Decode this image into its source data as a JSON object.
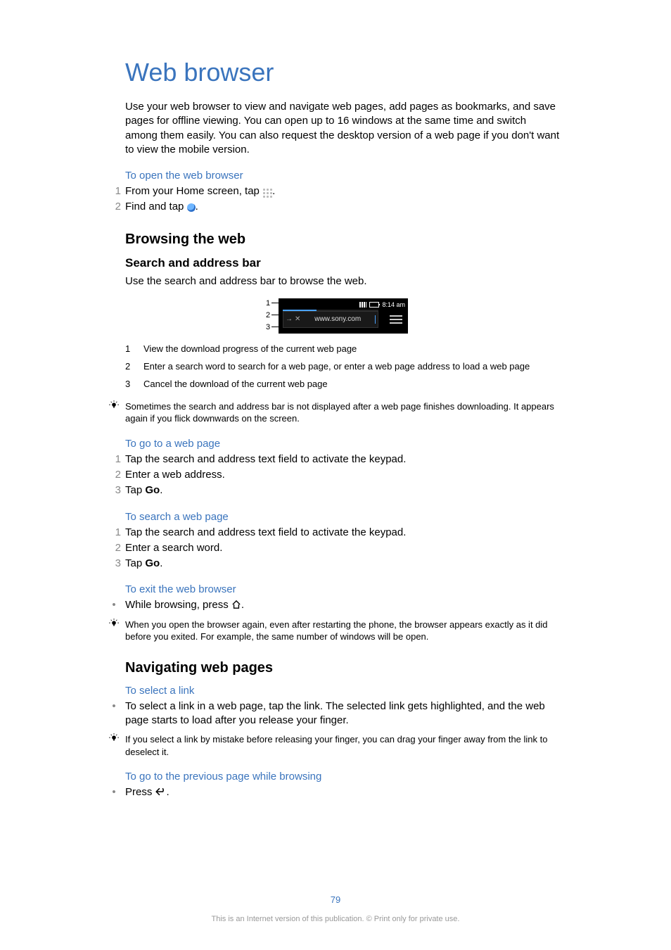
{
  "title": "Web browser",
  "intro": "Use your web browser to view and navigate web pages, add pages as bookmarks, and save pages for offline viewing. You can open up to 16 windows at the same time and switch among them easily. You can also request the desktop version of a web page if you don't want to view the mobile version.",
  "open_browser": {
    "heading": "To open the web browser",
    "steps": [
      {
        "n": "1",
        "pre": "From your Home screen, tap ",
        "post": "."
      },
      {
        "n": "2",
        "pre": "Find and tap ",
        "post": "."
      }
    ]
  },
  "browsing_h2": "Browsing the web",
  "search_bar": {
    "h3": "Search and address bar",
    "body": "Use the search and address bar to browse the web.",
    "callouts": [
      "1",
      "2",
      "3"
    ],
    "mock": {
      "time": "8:14 am",
      "url": "www.sony.com"
    },
    "legend": [
      {
        "n": "1",
        "t": "View the download progress of the current web page"
      },
      {
        "n": "2",
        "t": "Enter a search word to search for a web page, or enter a web page address to load a web page"
      },
      {
        "n": "3",
        "t": "Cancel the download of the current web page"
      }
    ],
    "tip": "Sometimes the search and address bar is not displayed after a web page finishes downloading. It appears again if you flick downwards on the screen."
  },
  "goto_page": {
    "heading": "To go to a web page",
    "steps": [
      {
        "n": "1",
        "t": "Tap the search and address text field to activate the keypad."
      },
      {
        "n": "2",
        "t": "Enter a web address."
      },
      {
        "n": "3",
        "pre": "Tap ",
        "bold": "Go",
        "post": "."
      }
    ]
  },
  "search_page": {
    "heading": "To search a web page",
    "steps": [
      {
        "n": "1",
        "t": "Tap the search and address text field to activate the keypad."
      },
      {
        "n": "2",
        "t": "Enter a search word."
      },
      {
        "n": "3",
        "pre": "Tap ",
        "bold": "Go",
        "post": "."
      }
    ]
  },
  "exit_browser": {
    "heading": "To exit the web browser",
    "bullet": {
      "pre": "While browsing, press ",
      "post": "."
    },
    "tip": "When you open the browser again, even after restarting the phone, the browser appears exactly as it did before you exited. For example, the same number of windows will be open."
  },
  "nav_h2": "Navigating web pages",
  "select_link": {
    "heading": "To select a link",
    "bullet": "To select a link in a web page, tap the link. The selected link gets highlighted, and the web page starts to load after you release your finger.",
    "tip": "If you select a link by mistake before releasing your finger, you can drag your finger away from the link to deselect it."
  },
  "prev_page": {
    "heading": "To go to the previous page while browsing",
    "bullet": {
      "pre": "Press ",
      "post": "."
    }
  },
  "pagenum": "79",
  "footer": "This is an Internet version of this publication. © Print only for private use."
}
